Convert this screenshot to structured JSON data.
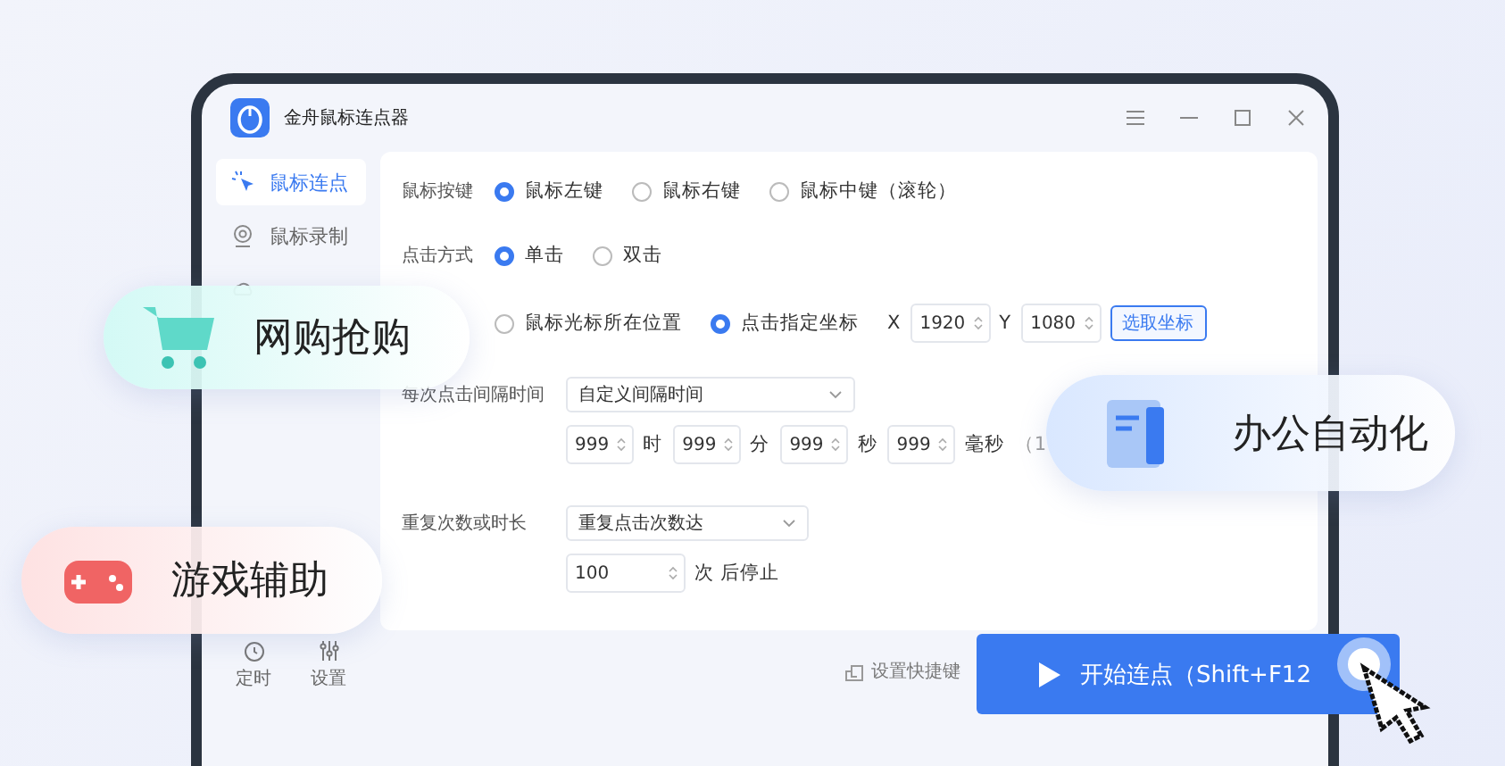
{
  "window": {
    "title": "金舟鼠标连点器"
  },
  "sidebar": {
    "items": [
      {
        "label": "鼠标连点",
        "selected": true
      },
      {
        "label": "鼠标录制",
        "selected": false
      },
      {
        "selected": false
      }
    ],
    "tools": [
      {
        "label": "定时"
      },
      {
        "label": "设置"
      }
    ]
  },
  "form": {
    "mouse_button": {
      "label": "鼠标按键",
      "options": [
        {
          "label": "鼠标左键",
          "selected": true
        },
        {
          "label": "鼠标右键",
          "selected": false
        },
        {
          "label": "鼠标中键（滚轮）",
          "selected": false
        }
      ]
    },
    "click_mode": {
      "label": "点击方式",
      "options": [
        {
          "label": "单击",
          "selected": true
        },
        {
          "label": "双击",
          "selected": false
        }
      ]
    },
    "click_position": {
      "options": [
        {
          "label": "鼠标光标所在位置",
          "selected": false
        },
        {
          "label": "点击指定坐标",
          "selected": true
        }
      ],
      "x": {
        "label": "X",
        "value": "1920"
      },
      "y": {
        "label": "Y",
        "value": "1080"
      },
      "pick_button": "选取坐标"
    },
    "interval": {
      "label": "每次点击间隔时间",
      "dropdown": "自定义间隔时间",
      "fields": [
        {
          "value": "999",
          "unit": "时"
        },
        {
          "value": "999",
          "unit": "分"
        },
        {
          "value": "999",
          "unit": "秒"
        },
        {
          "value": "999",
          "unit": "毫秒"
        }
      ],
      "hint": "（1"
    },
    "repeat": {
      "label": "重复次数或时长",
      "dropdown": "重复点击次数达",
      "count": {
        "value": "100",
        "unit": "次 后停止"
      }
    }
  },
  "footer": {
    "shortcut": "设置快捷键",
    "start_button": "开始连点（Shift+F12"
  },
  "badges": [
    {
      "label": "网购抢购",
      "kind": "cart"
    },
    {
      "label": "办公自动化",
      "kind": "document"
    },
    {
      "label": "游戏辅助",
      "kind": "gamepad"
    }
  ]
}
